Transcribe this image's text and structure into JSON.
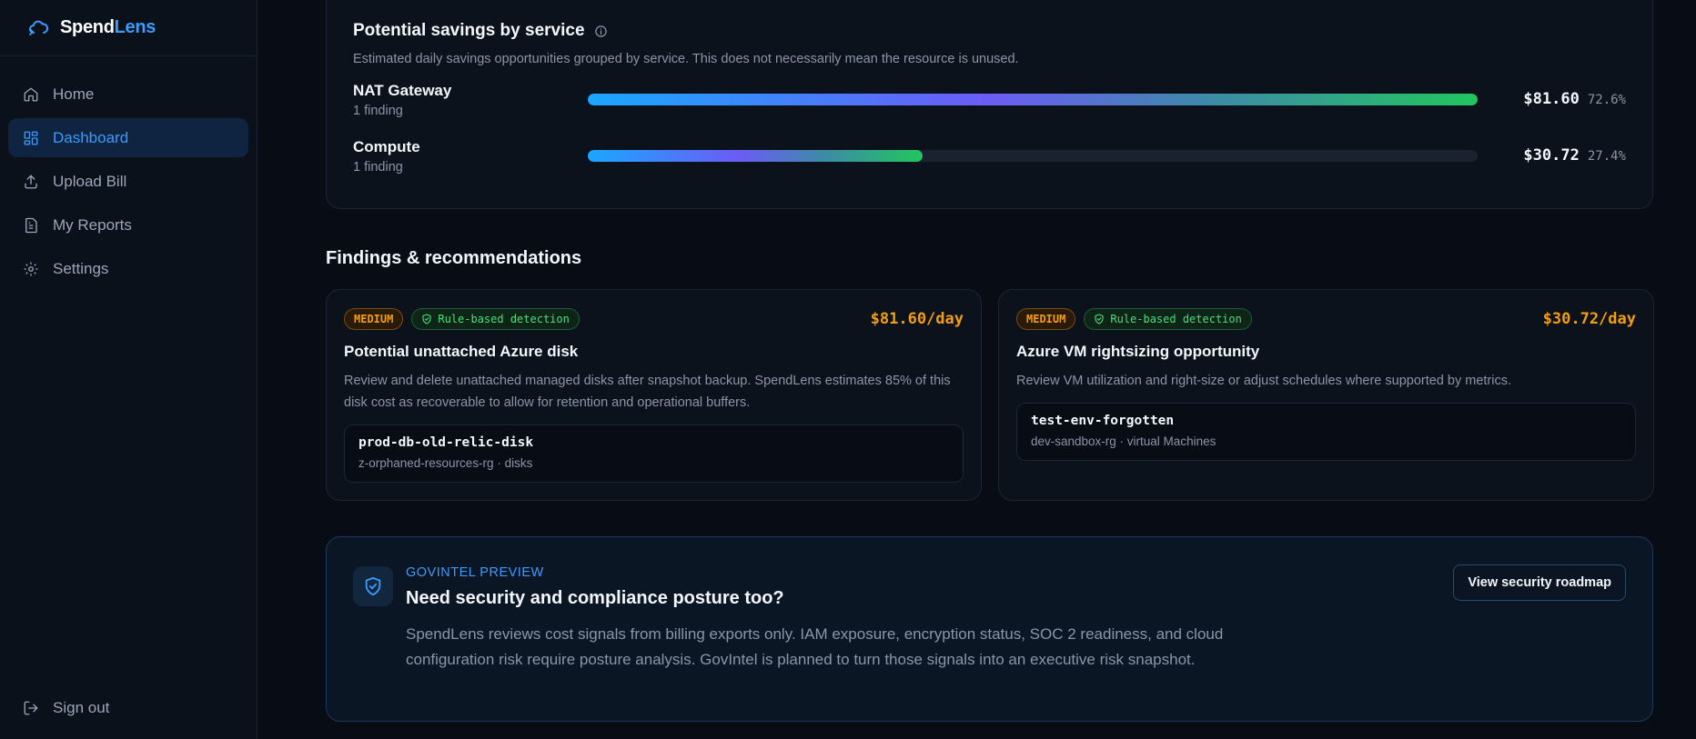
{
  "brand": {
    "name_part1": "Spend",
    "name_part2": "Lens",
    "icon": "cloud-logo-icon"
  },
  "sidebar": {
    "items": [
      {
        "label": "Home",
        "icon": "home-icon"
      },
      {
        "label": "Dashboard",
        "icon": "dashboard-icon",
        "active": true
      },
      {
        "label": "Upload Bill",
        "icon": "upload-icon"
      },
      {
        "label": "My Reports",
        "icon": "document-icon"
      },
      {
        "label": "Settings",
        "icon": "gear-icon"
      }
    ],
    "signout_label": "Sign out"
  },
  "savings": {
    "title": "Potential savings by service",
    "subtitle": "Estimated daily savings opportunities grouped by service. This does not necessarily mean the resource is unused.",
    "services": [
      {
        "name": "NAT Gateway",
        "findings": "1 finding",
        "amount": "$81.60",
        "pct": "72.6%",
        "bar_fraction": 1.0
      },
      {
        "name": "Compute",
        "findings": "1 finding",
        "amount": "$30.72",
        "pct": "27.4%",
        "bar_fraction": 0.376
      }
    ]
  },
  "findings_section": {
    "title": "Findings & recommendations",
    "cards": [
      {
        "severity": "MEDIUM",
        "detection": "Rule-based detection",
        "amount": "$81.60/day",
        "title": "Potential unattached Azure disk",
        "description": "Review and delete unattached managed disks after snapshot backup. SpendLens estimates 85% of this disk cost as recoverable to allow for retention and operational buffers.",
        "resource_name": "prod-db-old-relic-disk",
        "resource_meta": "z-orphaned-resources-rg · disks"
      },
      {
        "severity": "MEDIUM",
        "detection": "Rule-based detection",
        "amount": "$30.72/day",
        "title": "Azure VM rightsizing opportunity",
        "description": "Review VM utilization and right-size or adjust schedules where supported by metrics.",
        "resource_name": "test-env-forgotten",
        "resource_meta": "dev-sandbox-rg · virtual Machines"
      }
    ]
  },
  "govintel": {
    "eyebrow": "GOVINTEL PREVIEW",
    "title": "Need security and compliance posture too?",
    "description": "SpendLens reviews cost signals from billing exports only. IAM exposure, encryption status, SOC 2 readiness, and cloud configuration risk require posture analysis. GovIntel is planned to turn those signals into an executive risk snapshot.",
    "button_label": "View security roadmap"
  },
  "colors": {
    "accent": "#3b9bff",
    "warning": "#f59e0b",
    "success": "#4ade80",
    "background": "#080c14"
  }
}
